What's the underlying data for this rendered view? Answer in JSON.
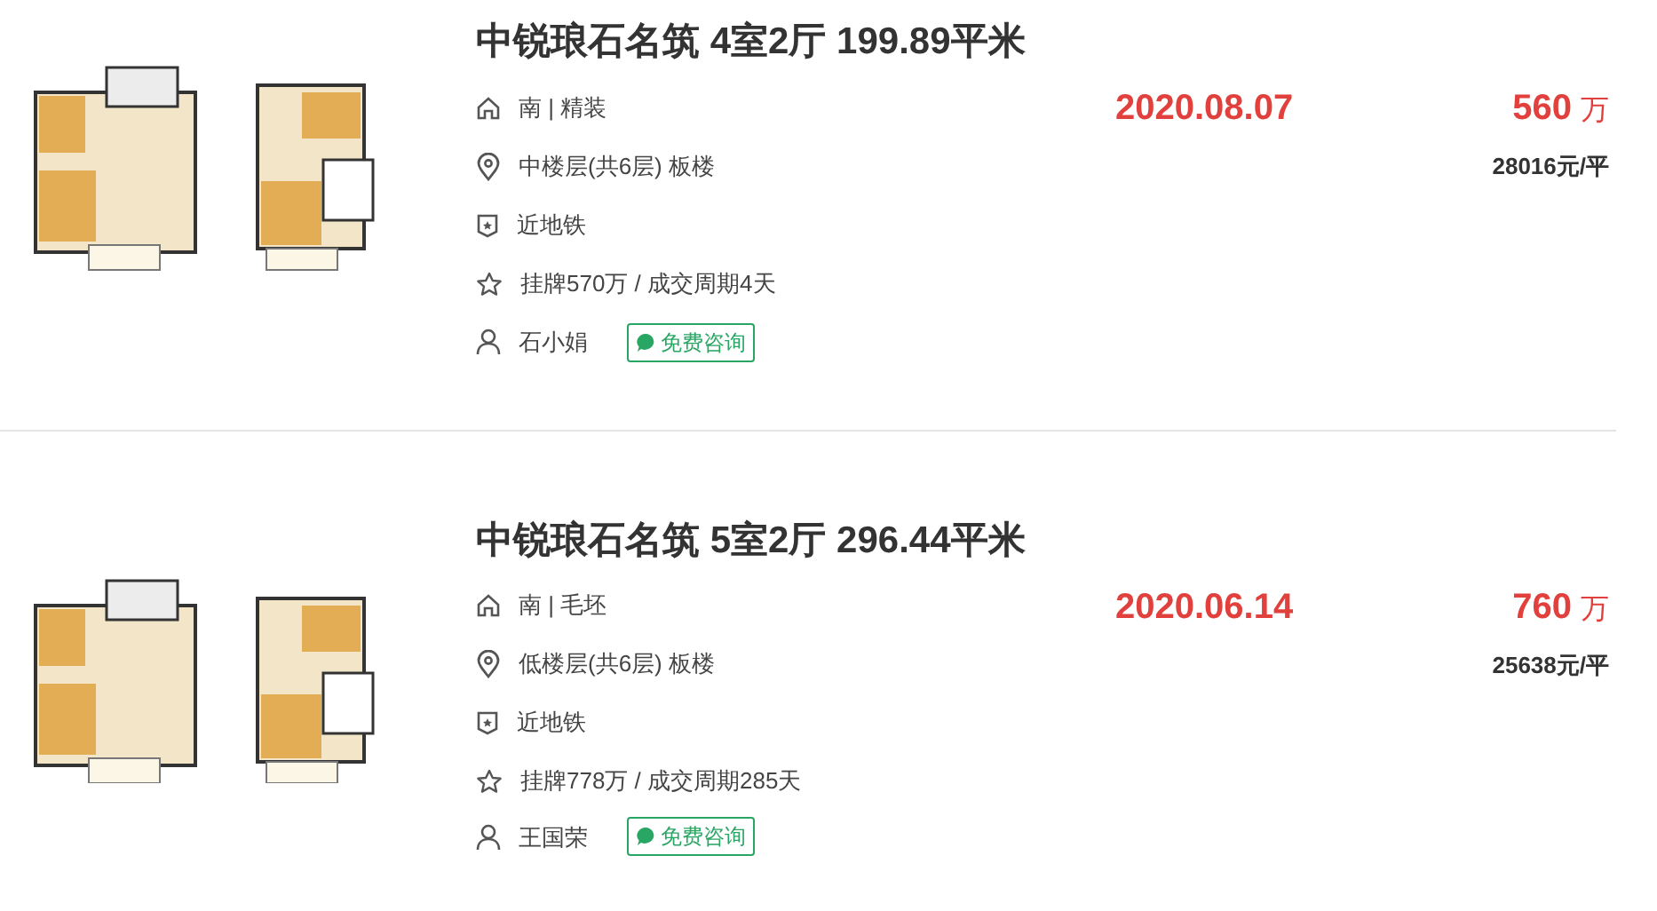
{
  "listings": [
    {
      "title": "中锐琅石名筑 4室2厅 199.89平米",
      "info": [
        {
          "kind": "house",
          "text": "南 | 精装"
        },
        {
          "kind": "location",
          "text": "中楼层(共6层) 板楼"
        },
        {
          "kind": "badge",
          "text": "近地铁"
        },
        {
          "kind": "star",
          "text": "挂牌570万 / 成交周期4天"
        }
      ],
      "agent": "石小娟",
      "consult_button": "免费咨询",
      "date": "2020.08.07",
      "price": "560",
      "price_unit": "万",
      "unit_price": "28016元/平"
    },
    {
      "title": "中锐琅石名筑 5室2厅 296.44平米",
      "info": [
        {
          "kind": "house",
          "text": "南 | 毛坯"
        },
        {
          "kind": "location",
          "text": "低楼层(共6层) 板楼"
        },
        {
          "kind": "badge",
          "text": "近地铁"
        },
        {
          "kind": "star",
          "text": "挂牌778万 / 成交周期285天"
        }
      ],
      "agent": "王国荣",
      "consult_button": "免费咨询",
      "date": "2020.06.14",
      "price": "760",
      "price_unit": "万",
      "unit_price": "25638元/平"
    }
  ]
}
